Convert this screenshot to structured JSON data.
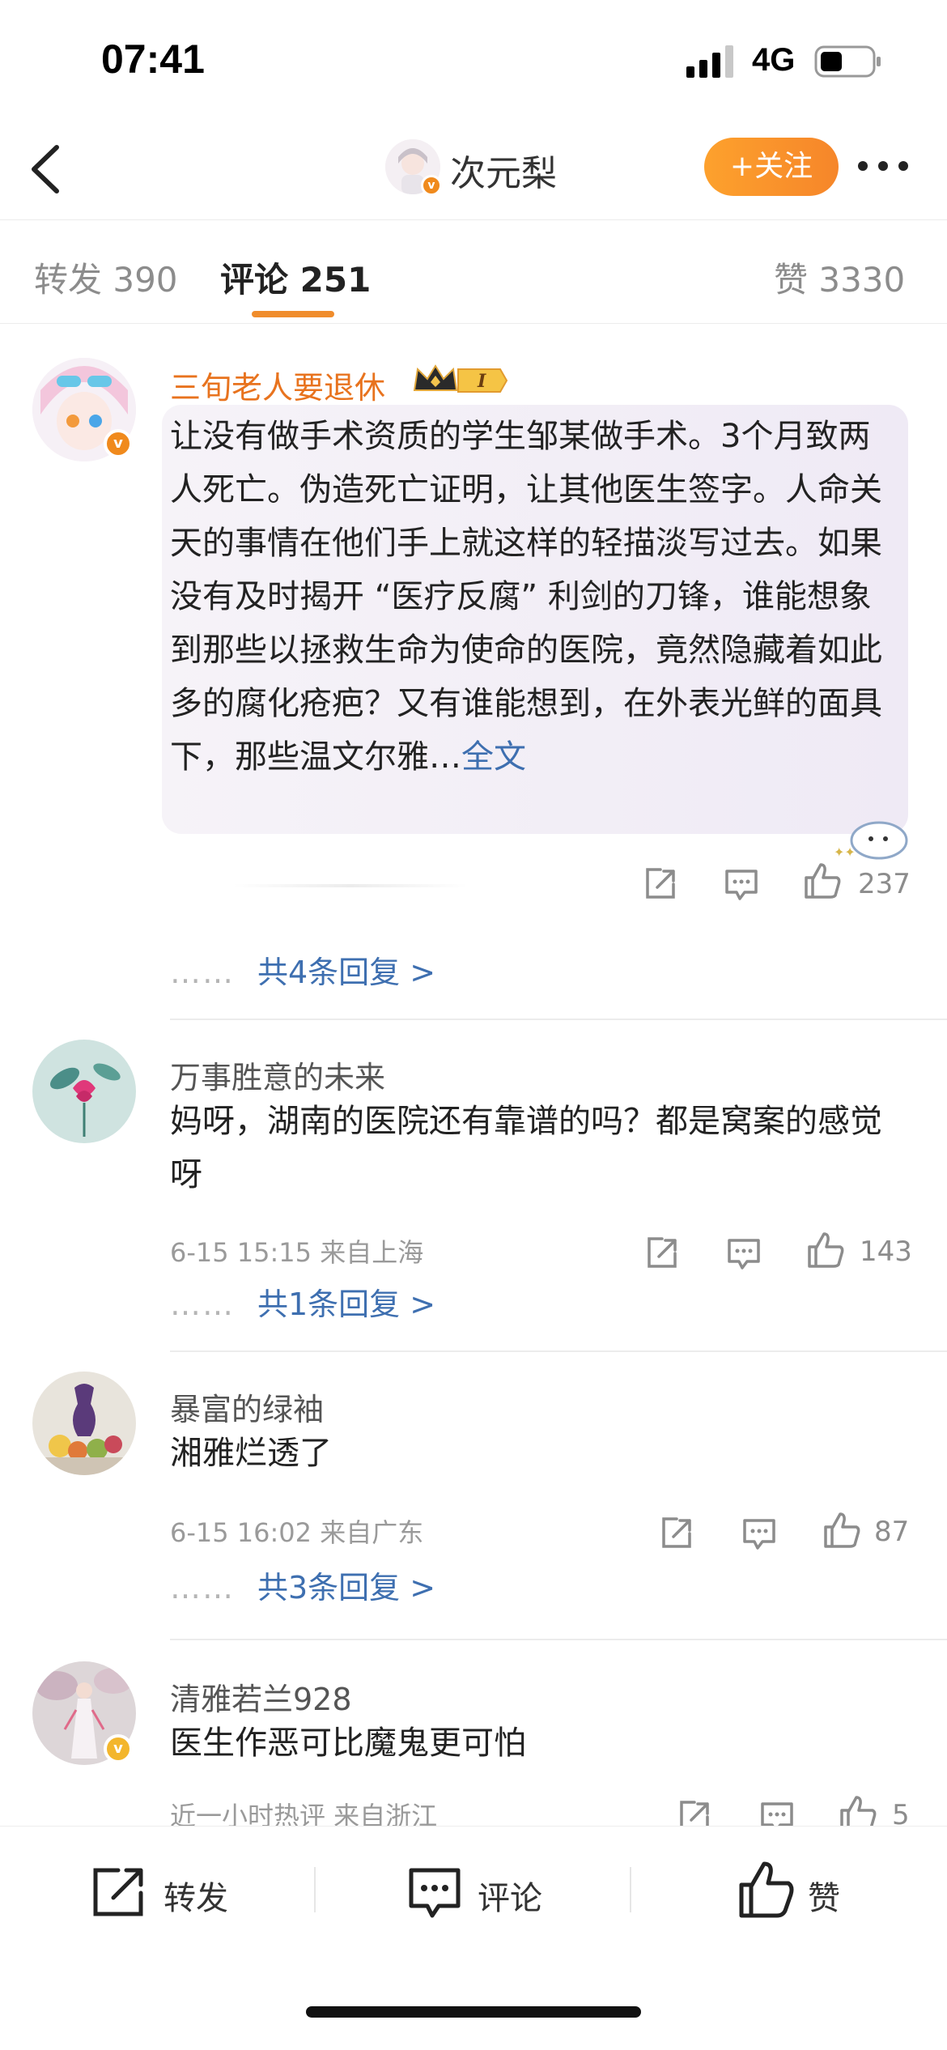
{
  "status_bar": {
    "time": "07:41",
    "network": "4G",
    "icons": [
      "signal-bars-icon",
      "battery-icon"
    ]
  },
  "nav": {
    "title": "次元梨",
    "follow_label": "+关注",
    "icons": [
      "back-arrow-icon",
      "more-dots-icon"
    ]
  },
  "tabs": [
    {
      "label": "转发 390",
      "active": false
    },
    {
      "label": "评论 251",
      "active": true
    },
    {
      "label": "赞 3330",
      "active": false
    }
  ],
  "comments": [
    {
      "user": "三旬老人要退休",
      "vip_level": "I",
      "text": "让没有做手术资质的学生邹某做手术。3个月致两人死亡。伪造死亡证明，让其他医生签字。人命关天的事情在他们手上就这样的轻描淡写过去。如果没有及时揭开 “医疗反腐” 利剑的刀锋，谁能想象到那些以拯救生命为使命的医院，竟然隐藏着如此多的腐化疮疤？又有谁能想到，在外表光鲜的面具下，那些温文尔雅…",
      "full_link": "全文",
      "meta": "",
      "likes": "237",
      "replies": "共4条回复 >"
    },
    {
      "user": "万事胜意的未来",
      "text": "妈呀，湖南的医院还有靠谱的吗？都是窝案的感觉呀",
      "meta": "6-15 15:15  来自上海",
      "likes": "143",
      "replies": "共1条回复 >"
    },
    {
      "user": "暴富的绿袖",
      "text": "湘雅烂透了",
      "meta": "6-15 16:02  来自广东",
      "likes": "87",
      "replies": "共3条回复 >"
    },
    {
      "user": "清雅若兰928",
      "text": "医生作恶可比魔鬼更可怕",
      "meta": "近一小时热评  来自浙江",
      "likes": "5",
      "replies": ""
    }
  ],
  "reply_dots": "……",
  "bottom_bar": {
    "repost": "转发",
    "comment": "评论",
    "like": "赞"
  },
  "colors": {
    "accent_orange": "#f6862a",
    "link_blue": "#3e6fb0",
    "vip_name": "#e8731e"
  }
}
